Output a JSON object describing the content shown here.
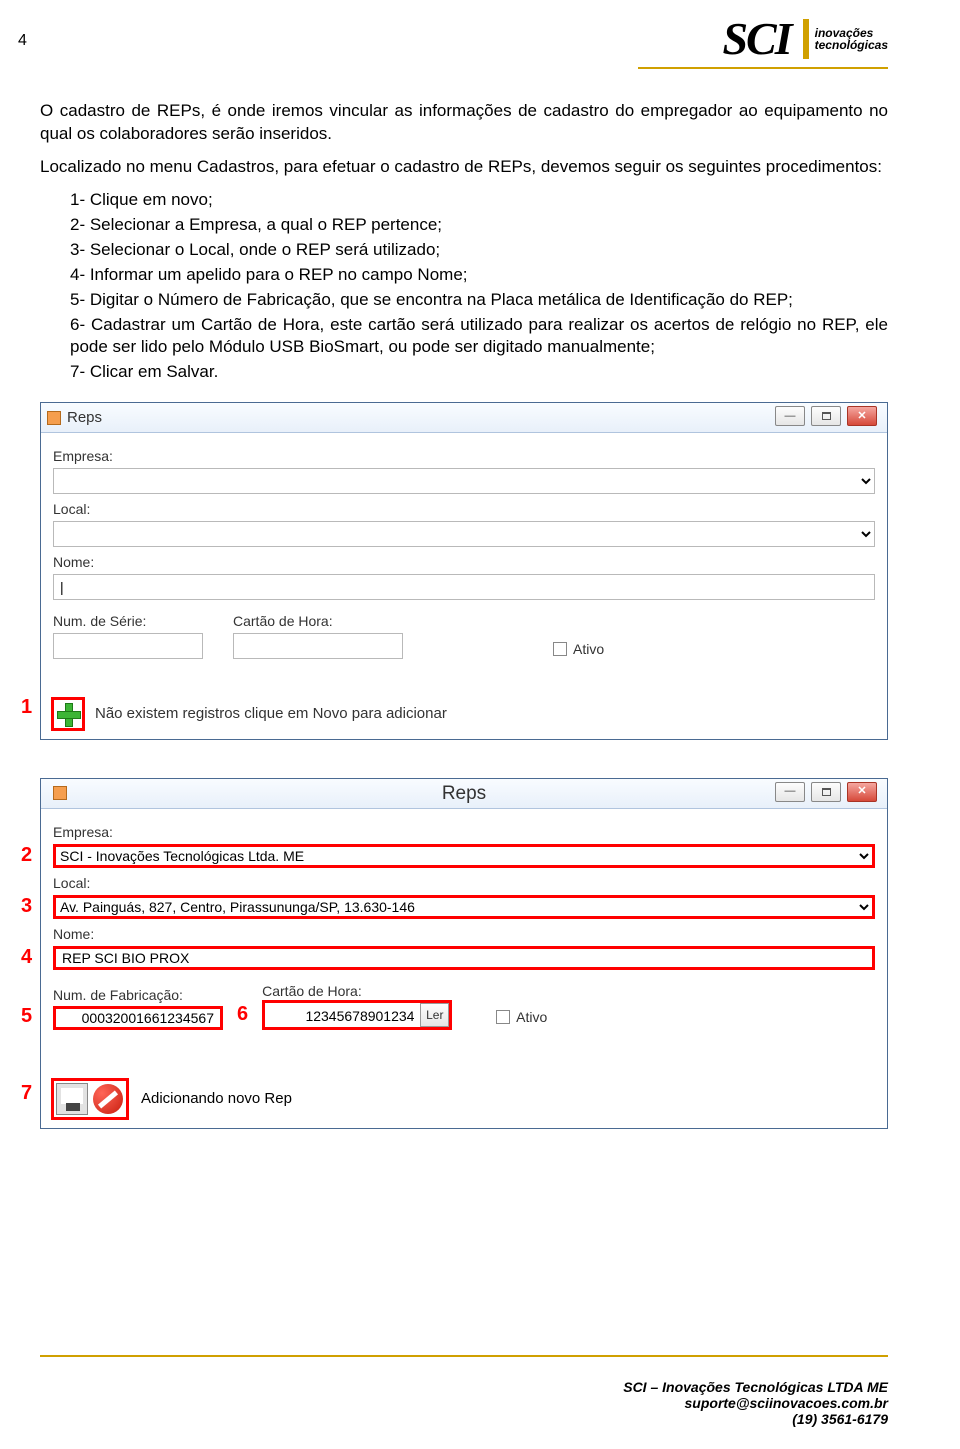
{
  "page_number": "4",
  "brand": {
    "name": "SCI",
    "tagline1": "inovações",
    "tagline2": "tecnológicas"
  },
  "text": {
    "p1": "O cadastro de REPs, é onde iremos vincular as informações de cadastro do empregador ao equipamento no qual os colaboradores serão inseridos.",
    "p2": "Localizado no menu Cadastros, para efetuar o cadastro de REPs, devemos seguir os seguintes procedimentos:",
    "items": [
      "1-  Clique em novo;",
      "2-  Selecionar a Empresa, a qual o REP pertence;",
      "3-  Selecionar o Local, onde o REP será utilizado;",
      "4-  Informar um apelido para o REP no campo Nome;",
      "5-  Digitar o Número de Fabricação, que se encontra na Placa metálica de Identificação do REP;",
      "6-  Cadastrar um Cartão de Hora, este cartão será utilizado para realizar os acertos de relógio no REP, ele pode ser lido pelo Módulo USB BioSmart, ou pode ser digitado manualmente;",
      "7-  Clicar em Salvar."
    ]
  },
  "win1": {
    "title": "Reps",
    "labels": {
      "empresa": "Empresa:",
      "local": "Local:",
      "nome": "Nome:",
      "num_serie": "Num. de Série:",
      "cartao": "Cartão de Hora:",
      "ativo": "Ativo"
    },
    "status": "Não existem registros clique em Novo para adicionar"
  },
  "win2": {
    "title": "Reps",
    "labels": {
      "empresa": "Empresa:",
      "local": "Local:",
      "nome": "Nome:",
      "num_fab": "Num. de Fabricação:",
      "cartao": "Cartão de Hora:",
      "ativo": "Ativo",
      "ler": "Ler"
    },
    "values": {
      "empresa": "SCI - Inovações Tecnológicas Ltda. ME",
      "local": "Av. Painguás, 827, Centro, Pirassununga/SP, 13.630-146",
      "nome": "REP SCI BIO PROX",
      "num_fab": "00032001661234567",
      "cartao": "12345678901234"
    },
    "status": "Adicionando novo Rep"
  },
  "callouts": {
    "c1": "1",
    "c2": "2",
    "c3": "3",
    "c4": "4",
    "c5": "5",
    "c6": "6",
    "c7": "7"
  },
  "footer": {
    "line1": "SCI – Inovações Tecnológicas LTDA ME",
    "line2": "suporte@sciinovacoes.com.br",
    "line3": "(19) 3561-6179"
  }
}
